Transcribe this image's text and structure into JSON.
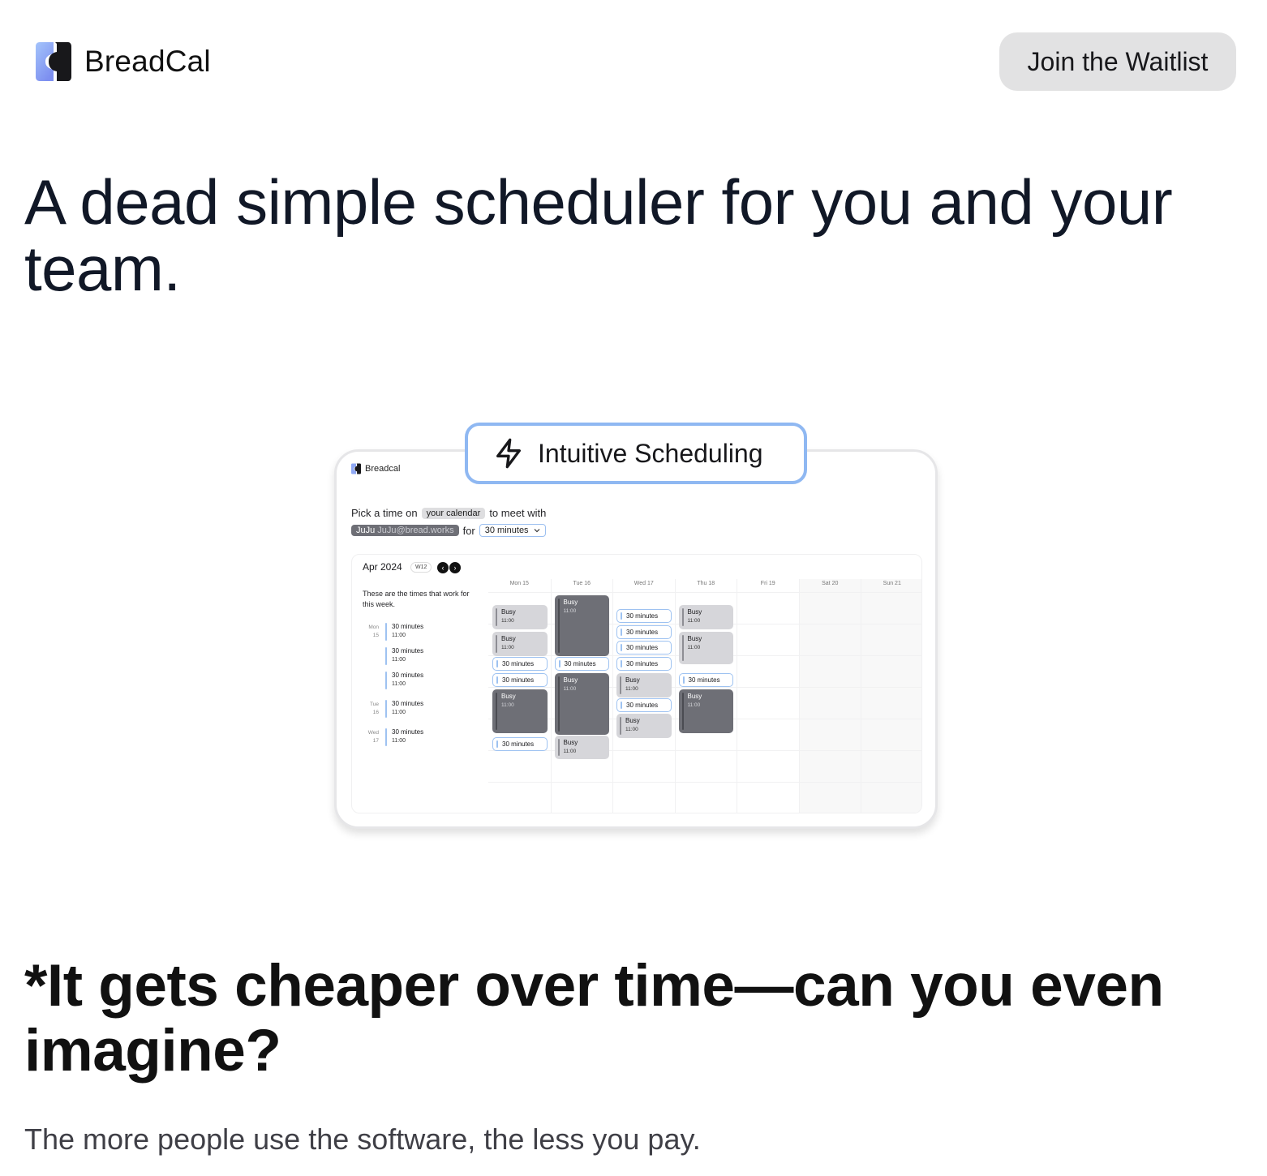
{
  "header": {
    "brand": "BreadCal",
    "cta_label": "Join the Waitlist"
  },
  "hero": {
    "title": "A dead simple scheduler for you and your team."
  },
  "feature_badge": {
    "icon": "lightning-bolt-icon",
    "label": "Intuitive Scheduling"
  },
  "demo": {
    "brand": "Breadcal",
    "pick_prefix": "Pick a time on",
    "calendar_chip": "your calendar",
    "pick_suffix": "to meet with",
    "user_name": "JuJu",
    "user_email": "JuJu@bread.works",
    "for_label": "for",
    "duration_value": "30 minutes",
    "calendar": {
      "month": "Apr 2024",
      "week": "W12",
      "prev_icon": "chevron-left-icon",
      "next_icon": "chevron-right-icon",
      "description": "These are the times that work for this week.",
      "available": [
        {
          "day": "Mon",
          "date": "15",
          "title": "30 minutes",
          "time": "11:00"
        },
        {
          "day": "",
          "date": "",
          "title": "30 minutes",
          "time": "11:00"
        },
        {
          "day": "",
          "date": "",
          "title": "30 minutes",
          "time": "11:00"
        },
        {
          "day": "Tue",
          "date": "16",
          "title": "30 minutes",
          "time": "11:00"
        },
        {
          "day": "Wed",
          "date": "17",
          "title": "30 minutes",
          "time": "11:00"
        }
      ],
      "days": [
        "Mon 15",
        "Tue 16",
        "Wed 17",
        "Thu 18",
        "Fri 19",
        "Sat 20",
        "Sun 21"
      ],
      "events": [
        {
          "day": 0,
          "type": "busy-light",
          "title": "Busy",
          "time": "11:00"
        },
        {
          "day": 0,
          "type": "busy-light",
          "title": "Busy",
          "time": "11:00"
        },
        {
          "day": 0,
          "type": "slot",
          "title": "30 minutes"
        },
        {
          "day": 0,
          "type": "slot",
          "title": "30 minutes"
        },
        {
          "day": 0,
          "type": "busy-dark",
          "title": "Busy",
          "time": "11:00"
        },
        {
          "day": 0,
          "type": "slot",
          "title": "30 minutes"
        },
        {
          "day": 1,
          "type": "busy-dark",
          "title": "Busy",
          "time": "11:00"
        },
        {
          "day": 1,
          "type": "slot",
          "title": "30 minutes"
        },
        {
          "day": 1,
          "type": "busy-dark",
          "title": "Busy",
          "time": "11:00"
        },
        {
          "day": 1,
          "type": "busy-light",
          "title": "Busy",
          "time": "11:00"
        },
        {
          "day": 2,
          "type": "slot",
          "title": "30 minutes"
        },
        {
          "day": 2,
          "type": "slot",
          "title": "30 minutes"
        },
        {
          "day": 2,
          "type": "slot",
          "title": "30 minutes"
        },
        {
          "day": 2,
          "type": "slot",
          "title": "30 minutes"
        },
        {
          "day": 2,
          "type": "busy-light",
          "title": "Busy",
          "time": "11:00"
        },
        {
          "day": 2,
          "type": "slot",
          "title": "30 minutes"
        },
        {
          "day": 2,
          "type": "busy-light",
          "title": "Busy",
          "time": "11:00"
        },
        {
          "day": 3,
          "type": "busy-light",
          "title": "Busy",
          "time": "11:00"
        },
        {
          "day": 3,
          "type": "busy-light",
          "title": "Busy",
          "time": "11:00"
        },
        {
          "day": 3,
          "type": "slot",
          "title": "30 minutes"
        },
        {
          "day": 3,
          "type": "busy-dark",
          "title": "Busy",
          "time": "11:00"
        }
      ]
    }
  },
  "pricing": {
    "title": "*It gets cheaper over time—can you even imagine?",
    "subtitle": "The more people use the software, the less you pay."
  },
  "colors": {
    "accent_blue": "#9ec2f1",
    "badge_border": "#8fb8f2",
    "busy_light": "#d6d6da",
    "busy_dark": "#6e6f76",
    "cta_bg": "#e2e2e3",
    "text_dark": "#111827"
  }
}
